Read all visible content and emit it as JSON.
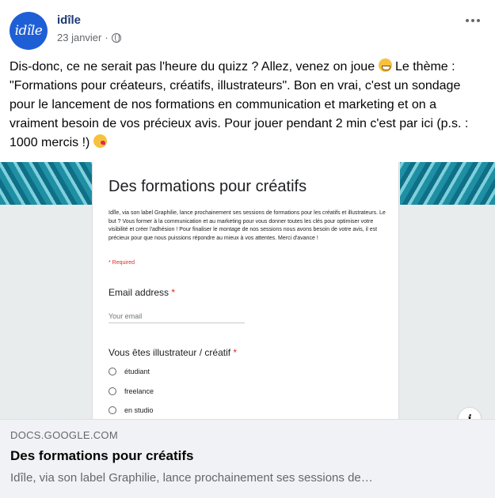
{
  "header": {
    "avatar_text": "idîle",
    "page_name": "idîle",
    "date": "23 janvier",
    "separator": "·"
  },
  "post": {
    "text_part1": "Dis-donc, ce ne serait pas l'heure du quizz ? Allez, venez on joue ",
    "text_part2": " Le thème : \"Formations pour créateurs, créatifs, illustrateurs\". Bon en vrai, c'est un sondage pour le lancement de nos formations en communication et marketing et on a vraiment besoin de vos précieux avis. Pour jouer pendant 2 min c'est par ici (p.s. : 1000 mercis !) "
  },
  "form_preview": {
    "title": "Des formations pour créatifs",
    "description": "Idîle, via son label Graphilie, lance prochainement ses sessions de formations pour les créatifs et illustrateurs. Le but ? Vous former à la communication et au marketing pour vous donner toutes les clés pour optimiser votre visibilité et créer l'adhésion ! Pour finaliser le montage de nos sessions nous avons besoin de votre avis, il est précieux pour que nous puissions répondre au mieux à vos attentes. Merci d'avance !",
    "required_note": "* Required",
    "q1_label": "Email address",
    "q1_placeholder": "Your email",
    "q2_label": "Vous êtes illustrateur / créatif",
    "star": "*",
    "options": [
      "étudiant",
      "freelance",
      "en studio"
    ]
  },
  "info_button": "i",
  "link": {
    "domain": "DOCS.GOOGLE.COM",
    "title": "Des formations pour créatifs",
    "description": "Idîle, via son label Graphilie, lance prochainement ses sessions de…"
  },
  "colors": {
    "avatar_bg": "#1f5fd6",
    "page_name": "#1f3a74",
    "footer_bg": "#f0f2f5",
    "pattern": "#1f8fa4"
  }
}
